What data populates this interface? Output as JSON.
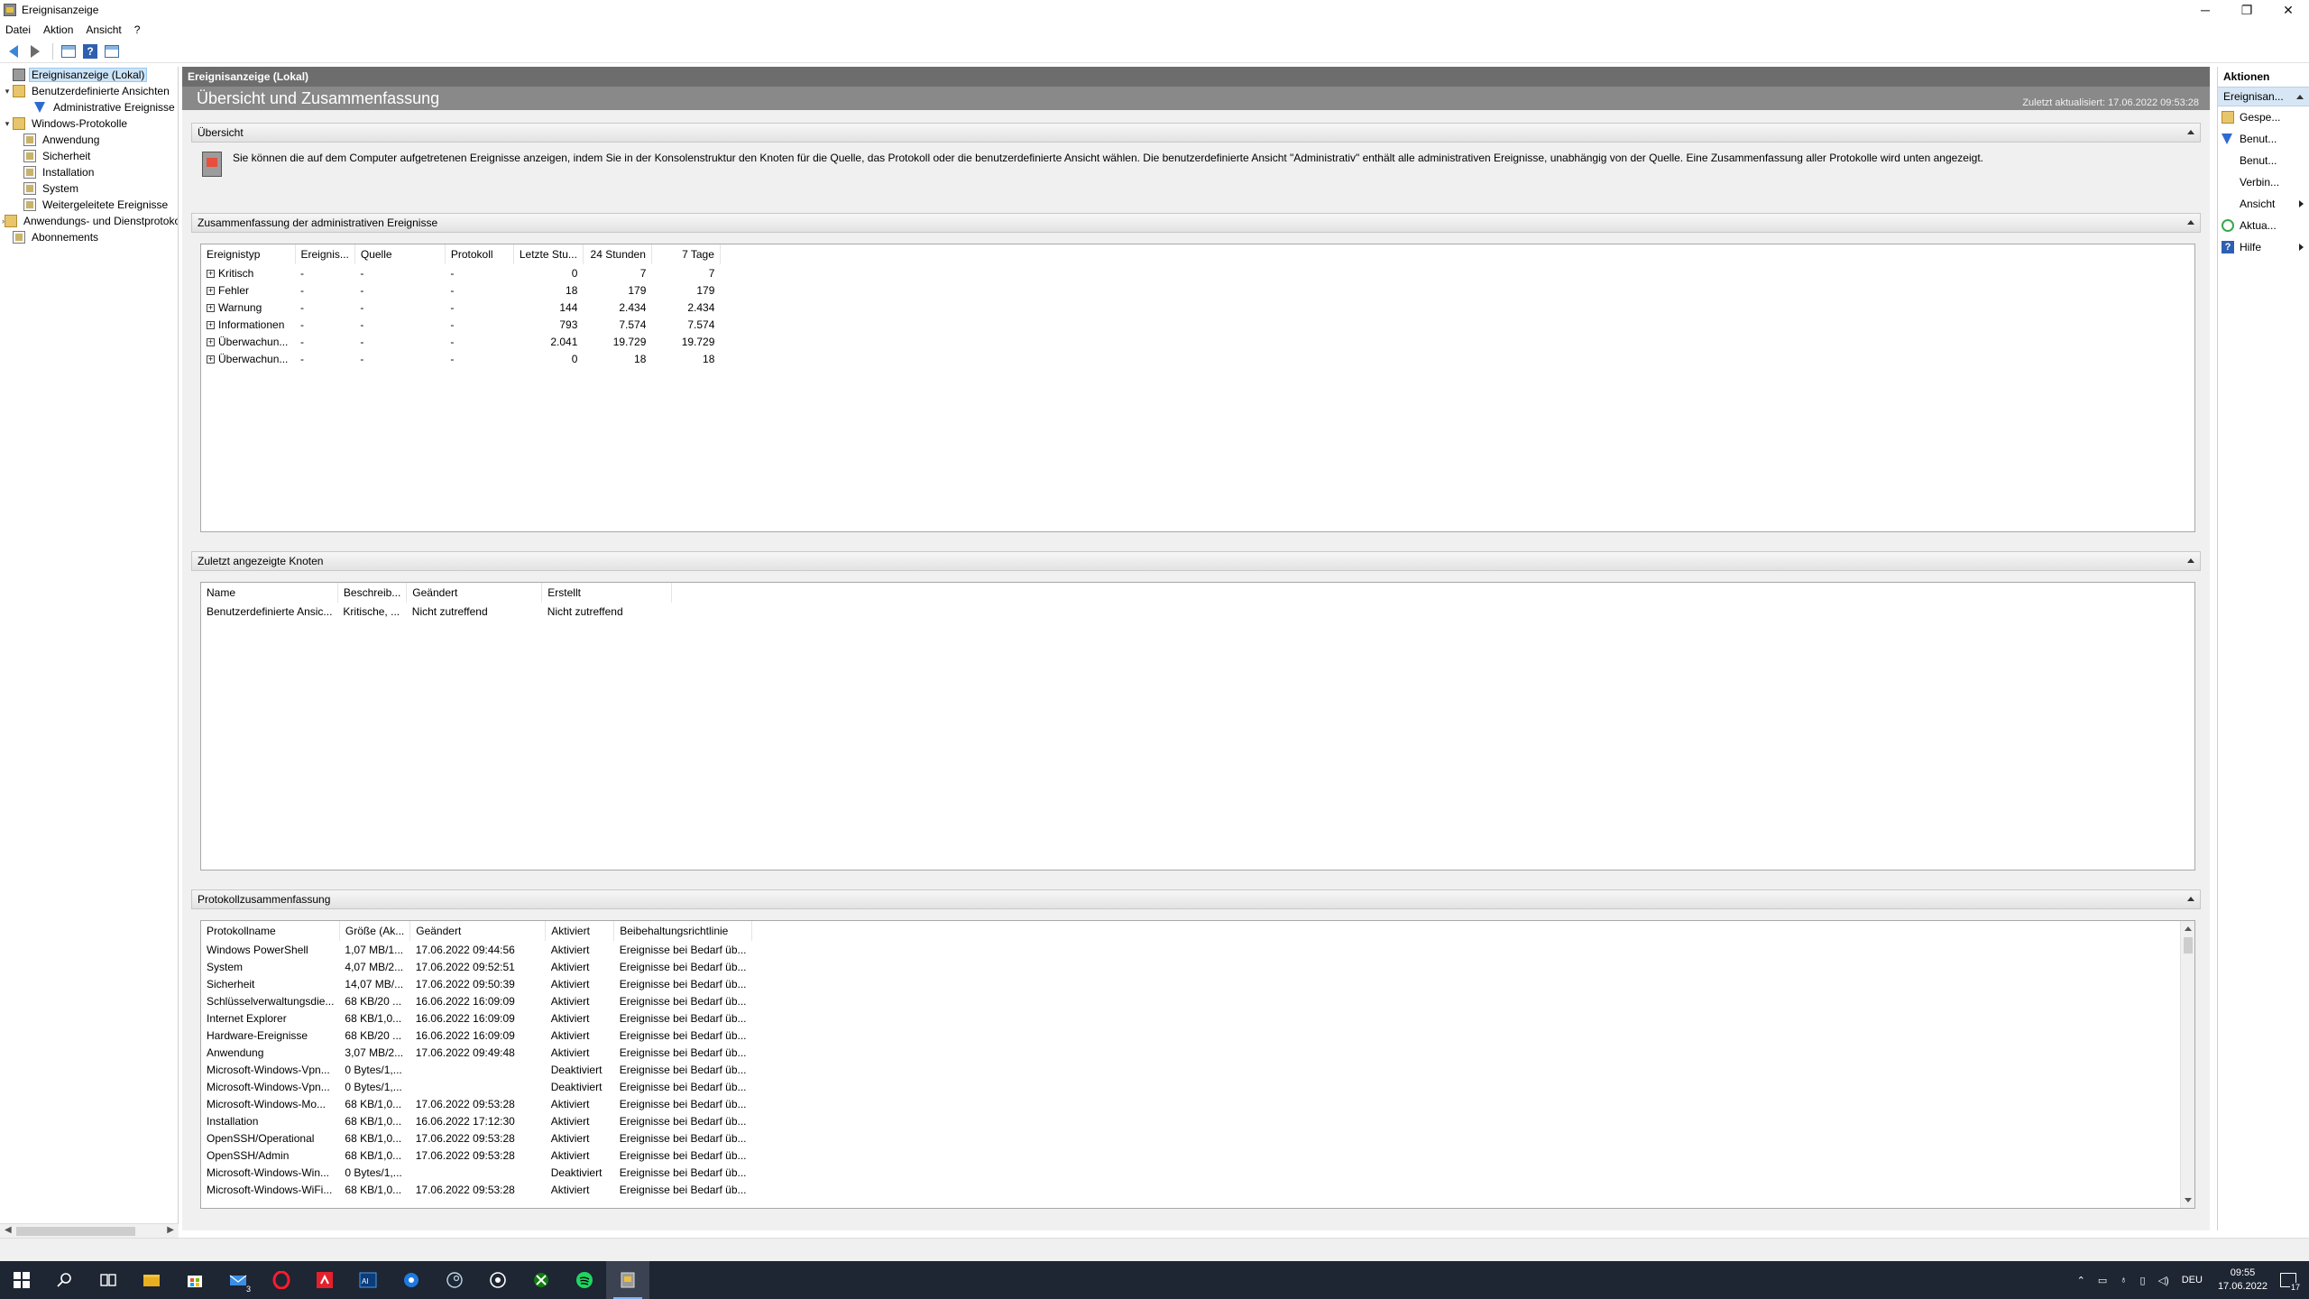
{
  "window": {
    "title": "Ereignisanzeige",
    "minimize": "─",
    "restore": "❐",
    "close": "✕"
  },
  "menu": [
    "Datei",
    "Aktion",
    "Ansicht",
    "?"
  ],
  "toolbar": {
    "icons": [
      "back-arrow-icon",
      "forward-arrow-icon",
      "show-hide-tree-icon",
      "help-icon",
      "show-hide-action-pane-icon"
    ]
  },
  "tree": {
    "items": [
      {
        "label": "Ereignisanzeige (Lokal)",
        "level": 0,
        "expander": "",
        "icon": "viewer",
        "selected": true
      },
      {
        "label": "Benutzerdefinierte Ansichten",
        "level": 0,
        "expander": "▾",
        "icon": "folder"
      },
      {
        "label": "Administrative Ereignisse",
        "level": 2,
        "expander": "",
        "icon": "filter"
      },
      {
        "label": "Windows-Protokolle",
        "level": 0,
        "expander": "▾",
        "icon": "folder"
      },
      {
        "label": "Anwendung",
        "level": 1,
        "expander": "",
        "icon": "log"
      },
      {
        "label": "Sicherheit",
        "level": 1,
        "expander": "",
        "icon": "log"
      },
      {
        "label": "Installation",
        "level": 1,
        "expander": "",
        "icon": "log"
      },
      {
        "label": "System",
        "level": 1,
        "expander": "",
        "icon": "log"
      },
      {
        "label": "Weitergeleitete Ereignisse",
        "level": 1,
        "expander": "",
        "icon": "log"
      },
      {
        "label": "Anwendungs- und Dienstprotokolle",
        "level": 0,
        "expander": "›",
        "icon": "folder"
      },
      {
        "label": "Abonnements",
        "level": 0,
        "expander": "",
        "icon": "log"
      }
    ]
  },
  "center": {
    "header": "Ereignisanzeige (Lokal)",
    "title": "Übersicht und Zusammenfassung",
    "updated": "Zuletzt aktualisiert: 17.06.2022 09:53:28",
    "overview": {
      "heading": "Übersicht",
      "text": "Sie können die auf dem Computer aufgetretenen Ereignisse anzeigen, indem Sie in der Konsolenstruktur den Knoten für die Quelle, das Protokoll oder die benutzerdefinierte Ansicht wählen. Die benutzerdefinierte Ansicht \"Administrativ\" enthält alle administrativen Ereignisse, unabhängig von der Quelle. Eine Zusammenfassung aller Protokolle wird unten angezeigt."
    },
    "admin_summary": {
      "heading": "Zusammenfassung der administrativen Ereignisse",
      "columns": [
        "Ereignistyp",
        "Ereignis...",
        "Quelle",
        "Protokoll",
        "Letzte Stu...",
        "24 Stunden",
        "7 Tage"
      ],
      "rows": [
        [
          "Kritisch",
          "-",
          "-",
          "-",
          "0",
          "7",
          "7"
        ],
        [
          "Fehler",
          "-",
          "-",
          "-",
          "18",
          "179",
          "179"
        ],
        [
          "Warnung",
          "-",
          "-",
          "-",
          "144",
          "2.434",
          "2.434"
        ],
        [
          "Informationen",
          "-",
          "-",
          "-",
          "793",
          "7.574",
          "7.574"
        ],
        [
          "Überwachun...",
          "-",
          "-",
          "-",
          "2.041",
          "19.729",
          "19.729"
        ],
        [
          "Überwachun...",
          "-",
          "-",
          "-",
          "0",
          "18",
          "18"
        ]
      ]
    },
    "recent_nodes": {
      "heading": "Zuletzt angezeigte Knoten",
      "columns": [
        "Name",
        "Beschreib...",
        "Geändert",
        "Erstellt"
      ],
      "rows": [
        [
          "Benutzerdefinierte Ansic...",
          "Kritische, ...",
          "Nicht zutreffend",
          "Nicht zutreffend"
        ]
      ]
    },
    "log_summary": {
      "heading": "Protokollzusammenfassung",
      "columns": [
        "Protokollname",
        "Größe (Ak...",
        "Geändert",
        "Aktiviert",
        "Beibehaltungsrichtlinie"
      ],
      "rows": [
        [
          "Windows PowerShell",
          "1,07 MB/1...",
          "17.06.2022 09:44:56",
          "Aktiviert",
          "Ereignisse bei Bedarf üb..."
        ],
        [
          "System",
          "4,07 MB/2...",
          "17.06.2022 09:52:51",
          "Aktiviert",
          "Ereignisse bei Bedarf üb..."
        ],
        [
          "Sicherheit",
          "14,07 MB/...",
          "17.06.2022 09:50:39",
          "Aktiviert",
          "Ereignisse bei Bedarf üb..."
        ],
        [
          "Schlüsselverwaltungsdie...",
          "68 KB/20 ...",
          "16.06.2022 16:09:09",
          "Aktiviert",
          "Ereignisse bei Bedarf üb..."
        ],
        [
          "Internet Explorer",
          "68 KB/1,0...",
          "16.06.2022 16:09:09",
          "Aktiviert",
          "Ereignisse bei Bedarf üb..."
        ],
        [
          "Hardware-Ereignisse",
          "68 KB/20 ...",
          "16.06.2022 16:09:09",
          "Aktiviert",
          "Ereignisse bei Bedarf üb..."
        ],
        [
          "Anwendung",
          "3,07 MB/2...",
          "17.06.2022 09:49:48",
          "Aktiviert",
          "Ereignisse bei Bedarf üb..."
        ],
        [
          "Microsoft-Windows-Vpn...",
          "0 Bytes/1,...",
          "",
          "Deaktiviert",
          "Ereignisse bei Bedarf üb..."
        ],
        [
          "Microsoft-Windows-Vpn...",
          "0 Bytes/1,...",
          "",
          "Deaktiviert",
          "Ereignisse bei Bedarf üb..."
        ],
        [
          "Microsoft-Windows-Mo...",
          "68 KB/1,0...",
          "17.06.2022 09:53:28",
          "Aktiviert",
          "Ereignisse bei Bedarf üb..."
        ],
        [
          "Installation",
          "68 KB/1,0...",
          "16.06.2022 17:12:30",
          "Aktiviert",
          "Ereignisse bei Bedarf üb..."
        ],
        [
          "OpenSSH/Operational",
          "68 KB/1,0...",
          "17.06.2022 09:53:28",
          "Aktiviert",
          "Ereignisse bei Bedarf üb..."
        ],
        [
          "OpenSSH/Admin",
          "68 KB/1,0...",
          "17.06.2022 09:53:28",
          "Aktiviert",
          "Ereignisse bei Bedarf üb..."
        ],
        [
          "Microsoft-Windows-Win...",
          "0 Bytes/1,...",
          "",
          "Deaktiviert",
          "Ereignisse bei Bedarf üb..."
        ],
        [
          "Microsoft-Windows-WiFi...",
          "68 KB/1,0...",
          "17.06.2022 09:53:28",
          "Aktiviert",
          "Ereignisse bei Bedarf üb..."
        ]
      ]
    }
  },
  "actions": {
    "header": "Aktionen",
    "section": "Ereignisan...",
    "items": [
      {
        "label": "Gespe...",
        "icon": "open",
        "submenu": false
      },
      {
        "label": "Benut...",
        "icon": "filter",
        "submenu": false
      },
      {
        "label": "Benut...",
        "icon": "blank",
        "submenu": false
      },
      {
        "label": "Verbin...",
        "icon": "blank",
        "submenu": false
      },
      {
        "label": "Ansicht",
        "icon": "blank",
        "submenu": true
      },
      {
        "label": "Aktua...",
        "icon": "refresh",
        "submenu": false
      },
      {
        "label": "Hilfe",
        "icon": "help",
        "submenu": true
      }
    ]
  },
  "taskbar": {
    "apps": [
      "start-icon",
      "search-icon",
      "task-view-icon",
      "file-explorer-icon",
      "store-icon",
      "mail-icon",
      "opera-icon",
      "amd-icon",
      "ai-suite-icon",
      "app-blue-icon",
      "steam-icon",
      "obs-icon",
      "xbox-icon",
      "spotify-icon",
      "event-viewer-icon"
    ],
    "mail_badge": "3",
    "language": "DEU",
    "time": "09:55",
    "date": "17.06.2022",
    "notifications": "17"
  },
  "colors": {
    "center_header": "#6d6d6d",
    "center_title": "#898989",
    "selection": "#cce4f7",
    "taskbar": "#1e2533"
  }
}
